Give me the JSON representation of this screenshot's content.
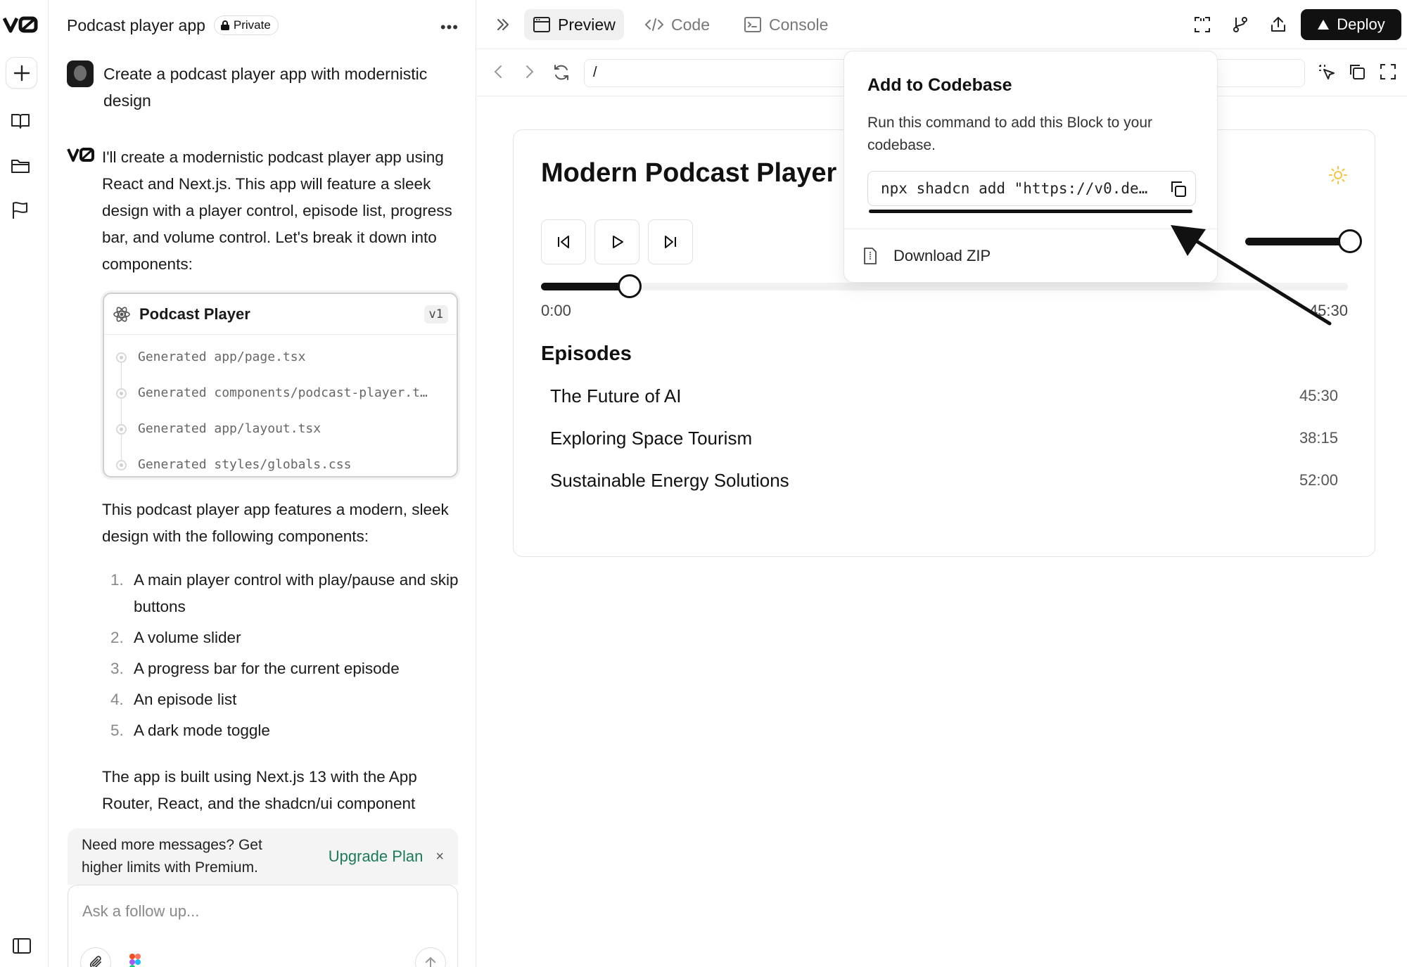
{
  "rail": {
    "items": [
      "new-chat",
      "library",
      "projects",
      "feedback"
    ]
  },
  "chat": {
    "title": "Podcast player app",
    "visibility": "Private",
    "user_message": "Create a podcast player app with modernistic design",
    "ai_intro": "I'll create a modernistic podcast player app using React and Next.js. This app will feature a sleek design with a player control, episode list, progress bar, and volume control. Let's break it down into components:",
    "block": {
      "title": "Podcast Player",
      "version": "v1",
      "files": [
        "Generated app/page.tsx",
        "Generated components/podcast-player.t…",
        "Generated app/layout.tsx",
        "Generated styles/globals.css"
      ]
    },
    "ai_features_intro": "This podcast player app features a modern, sleek design with the following components:",
    "features": [
      {
        "num": "1.",
        "text": "A main player control with play/pause and skip buttons"
      },
      {
        "num": "2.",
        "text": "A volume slider"
      },
      {
        "num": "3.",
        "text": "A progress bar for the current episode"
      },
      {
        "num": "4.",
        "text": "An episode list"
      },
      {
        "num": "5.",
        "text": "A dark mode toggle"
      }
    ],
    "ai_outro": "The app is built using Next.js 13 with the App Router, React, and the shadcn/ui component",
    "upgrade": {
      "text": "Need more messages? Get higher limits with Premium.",
      "link": "Upgrade Plan",
      "close": "×"
    },
    "composer_placeholder": "Ask a follow up..."
  },
  "topbar": {
    "tabs": [
      "Preview",
      "Code",
      "Console"
    ],
    "active_tab": "Preview",
    "deploy_label": "Deploy"
  },
  "urlbar": {
    "path": "/"
  },
  "app": {
    "title": "Modern Podcast Player",
    "time_start": "0:00",
    "time_end": "45:30",
    "progress_fraction": 0.11,
    "episodes_heading": "Episodes",
    "episodes": [
      {
        "title": "The Future of AI",
        "duration": "45:30"
      },
      {
        "title": "Exploring Space Tourism",
        "duration": "38:15"
      },
      {
        "title": "Sustainable Energy Solutions",
        "duration": "52:00"
      }
    ]
  },
  "popover": {
    "title": "Add to Codebase",
    "description": "Run this command to add this Block to your codebase.",
    "command": "npx shadcn add \"https://v0.de…",
    "download_label": "Download ZIP"
  },
  "colors": {
    "accent_link": "#1a7a5a",
    "deploy_bg": "#111111",
    "sun_icon": "#f5c542"
  }
}
